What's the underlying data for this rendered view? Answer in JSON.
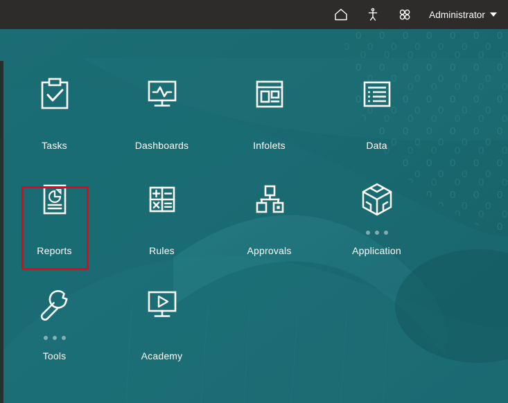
{
  "header": {
    "background_color": "#2e2c2b",
    "icons": [
      {
        "name": "home-icon",
        "title": "Home"
      },
      {
        "name": "accessibility-icon",
        "title": "Accessibility"
      },
      {
        "name": "navigator-icon",
        "title": "Navigator"
      }
    ],
    "user": {
      "label": "Administrator",
      "caret": "▾"
    }
  },
  "theme": {
    "background_color": "#1a6b73",
    "accent_color": "#ffffff",
    "highlight_color": "#f5000c"
  },
  "home": {
    "rows": [
      {
        "tiles": [
          {
            "label": "Tasks",
            "icon": "clipboard-check-icon",
            "has_dots": false,
            "highlighted": false
          },
          {
            "label": "Dashboards",
            "icon": "monitor-chart-icon",
            "has_dots": false,
            "highlighted": false
          },
          {
            "label": "Infolets",
            "icon": "layout-panels-icon",
            "has_dots": false,
            "highlighted": false
          },
          {
            "label": "Data",
            "icon": "data-grid-icon",
            "has_dots": false,
            "highlighted": false
          }
        ]
      },
      {
        "tiles": [
          {
            "label": "Reports",
            "icon": "report-pie-doc-icon",
            "has_dots": false,
            "highlighted": true
          },
          {
            "label": "Rules",
            "icon": "calculator-icon",
            "has_dots": false,
            "highlighted": false
          },
          {
            "label": "Approvals",
            "icon": "hierarchy-icon",
            "has_dots": false,
            "highlighted": false
          },
          {
            "label": "Application",
            "icon": "cube-icon",
            "has_dots": true,
            "highlighted": false
          }
        ]
      },
      {
        "tiles": [
          {
            "label": "Tools",
            "icon": "wrench-icon",
            "has_dots": true,
            "highlighted": false
          },
          {
            "label": "Academy",
            "icon": "monitor-play-icon",
            "has_dots": false,
            "highlighted": false
          }
        ]
      }
    ]
  },
  "annotation": {
    "target": "Reports",
    "shape": "rectangle",
    "color": "#f5000c"
  }
}
